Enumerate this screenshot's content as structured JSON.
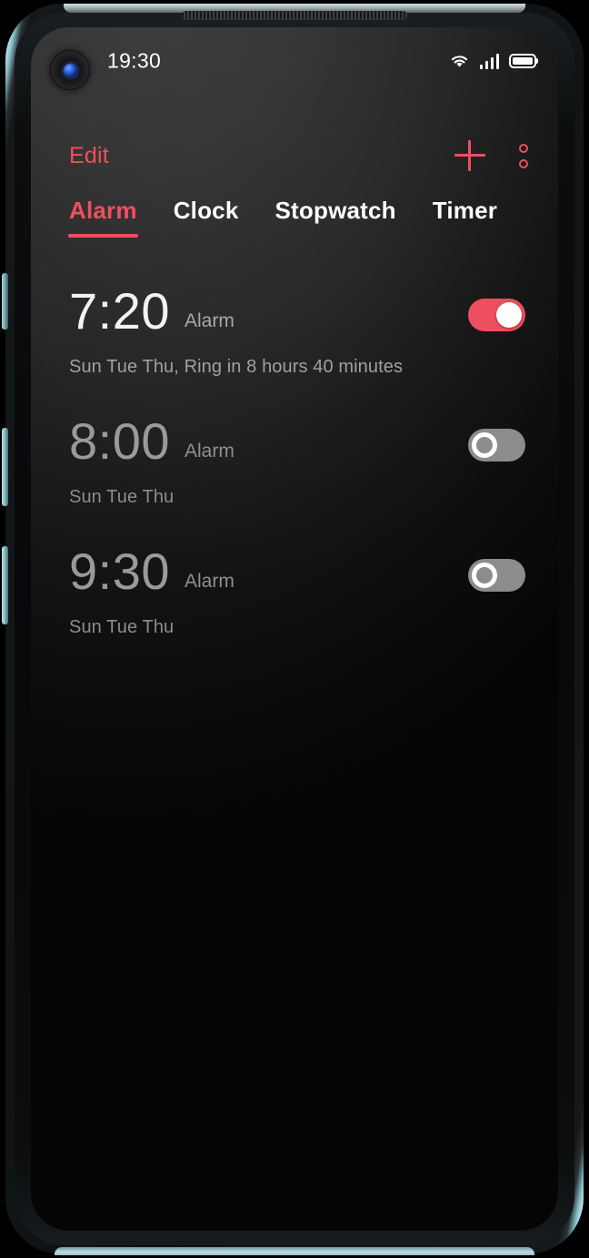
{
  "status_bar": {
    "time": "19:30",
    "icons": {
      "wifi": "wifi-icon",
      "signal": "cellular-signal-icon",
      "battery": "battery-full-icon"
    },
    "signal_bars": 4,
    "battery_level_percent": 100
  },
  "action_bar": {
    "edit_label": "Edit",
    "add_icon": "plus-icon",
    "more_icon": "more-options-icon"
  },
  "tabs": [
    {
      "label": "Alarm",
      "active": true
    },
    {
      "label": "Clock",
      "active": false
    },
    {
      "label": "Stopwatch",
      "active": false
    },
    {
      "label": "Timer",
      "active": false
    }
  ],
  "alarms": [
    {
      "time": "7:20",
      "label": "Alarm",
      "subtitle": "Sun Tue Thu, Ring in 8 hours 40 minutes",
      "enabled": true,
      "toggle_state": "on"
    },
    {
      "time": "8:00",
      "label": "Alarm",
      "subtitle": "Sun Tue Thu",
      "enabled": false,
      "toggle_state": "off"
    },
    {
      "time": "9:30",
      "label": "Alarm",
      "subtitle": "Sun Tue Thu",
      "enabled": false,
      "toggle_state": "off"
    }
  ],
  "colors": {
    "accent": "#ee4f5e",
    "text_primary": "#f2f2f2",
    "text_disabled": "#9a9a9a",
    "text_secondary": "#a0a0a0",
    "toggle_off_track": "#8c8c8c",
    "screen_top": "#323232",
    "screen_bottom": "#000000"
  }
}
